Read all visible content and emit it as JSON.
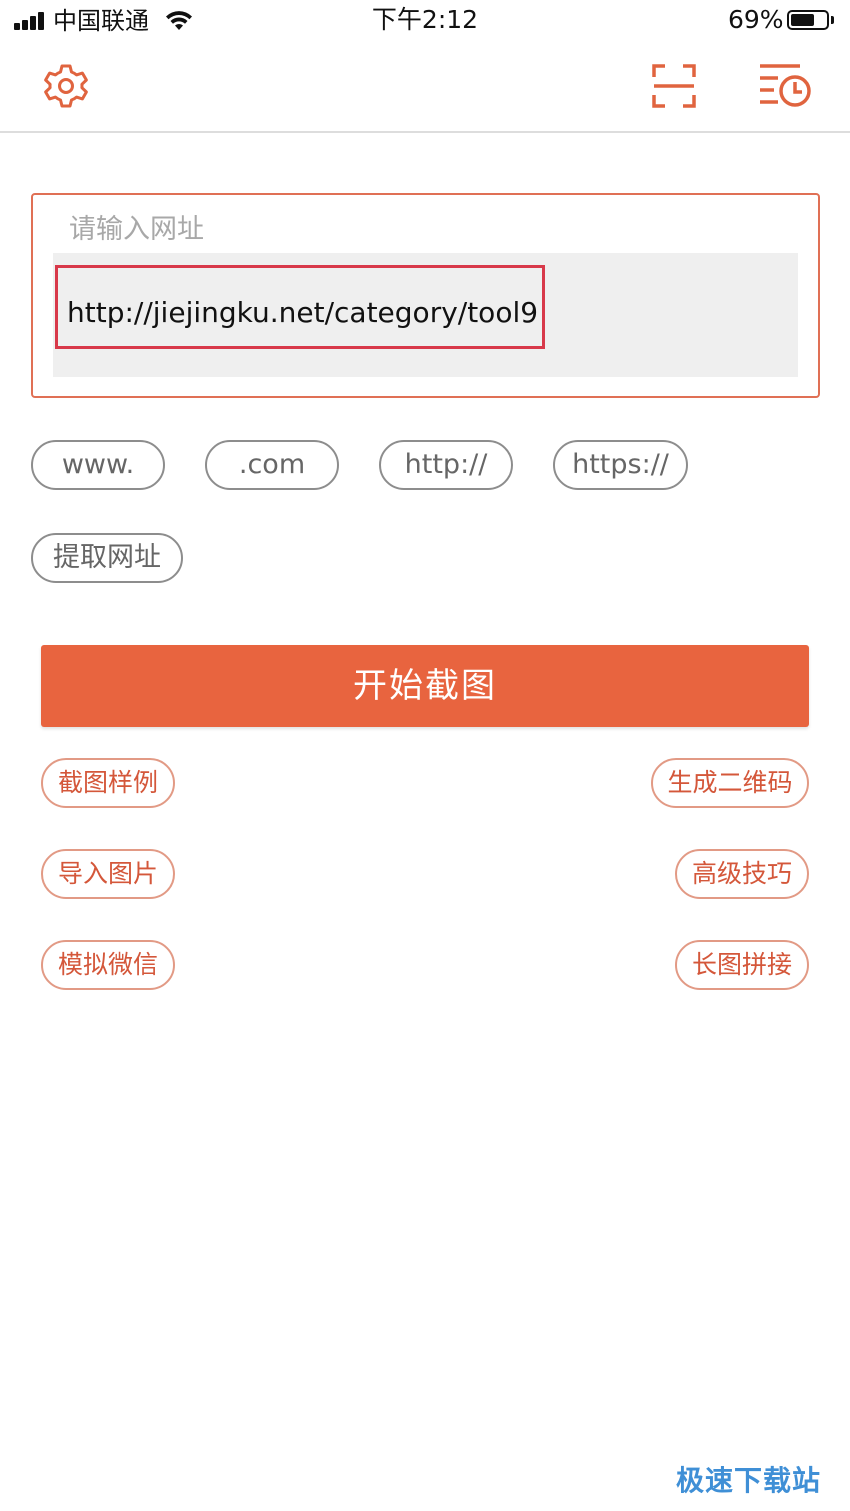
{
  "status_bar": {
    "carrier": "中国联通",
    "time": "下午2:12",
    "battery_percent": "69%",
    "battery_level": 0.69
  },
  "nav_bar": {
    "icons": [
      "gear-icon",
      "scan-icon",
      "history-icon"
    ]
  },
  "url_input": {
    "label": "请输入网址",
    "value": "http://jiejingku.net/category/tool9"
  },
  "quick_insert": {
    "chips": [
      "www.",
      ".com",
      "http://",
      "https://"
    ],
    "extract_label": "提取网址"
  },
  "primary_action": {
    "label": "开始截图"
  },
  "features": {
    "left": [
      "截图样例",
      "导入图片",
      "模拟微信"
    ],
    "right": [
      "生成二维码",
      "高级技巧",
      "长图拼接"
    ]
  },
  "watermark": {
    "text": "极速下载站"
  },
  "colors": {
    "accent": "#e8643f",
    "accent_text": "#d4573a",
    "highlight_frame": "#d8394a"
  }
}
